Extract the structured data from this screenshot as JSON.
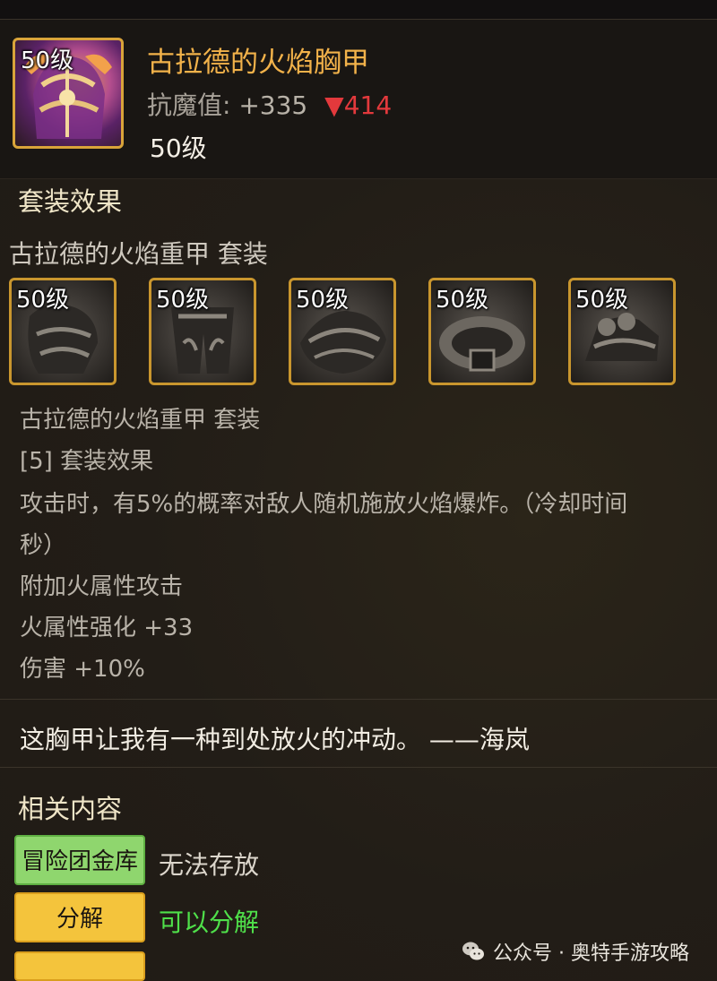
{
  "item": {
    "level_tag": "50级",
    "name": "古拉德的火焰胸甲",
    "stat_label": "抗魔值:",
    "stat_value": "+335",
    "stat_diff": "▼414",
    "level": "50级"
  },
  "set_section": {
    "title": "套装效果",
    "set_header": "古拉德的火焰重甲  套装",
    "pieces": [
      {
        "level_tag": "50级",
        "icon": "gloves-icon"
      },
      {
        "level_tag": "50级",
        "icon": "leg-armor-icon"
      },
      {
        "level_tag": "50级",
        "icon": "shoulder-armor-icon"
      },
      {
        "level_tag": "50级",
        "icon": "belt-icon"
      },
      {
        "level_tag": "50级",
        "icon": "boots-icon"
      }
    ],
    "set_name_line": "古拉德的火焰重甲  套装",
    "bonus_title": "[5] 套装效果",
    "effect_line1": "攻击时，有5%的概率对敌人随机施放火焰爆炸。（冷却时间",
    "effect_line2": "秒）",
    "effect_fire_attack": "附加火属性攻击",
    "effect_fire_enhance": "火属性强化 +33",
    "effect_damage": "伤害 +10%"
  },
  "quote": "这胸甲让我有一种到处放火的冲动。 ——海岚",
  "related": {
    "title": "相关内容",
    "storage_button": "冒险团金库",
    "storage_note": "无法存放",
    "storage_note_color": "#dcd6cc",
    "disassemble_button": "分解",
    "disassemble_note": "可以分解",
    "disassemble_note_color": "#4fe04a"
  },
  "watermark": "公众号 · 奥特手游攻略",
  "colors": {
    "item_name": "#f2b24a",
    "stat_down": "#e3393c",
    "frame_gold": "#c9962e"
  }
}
